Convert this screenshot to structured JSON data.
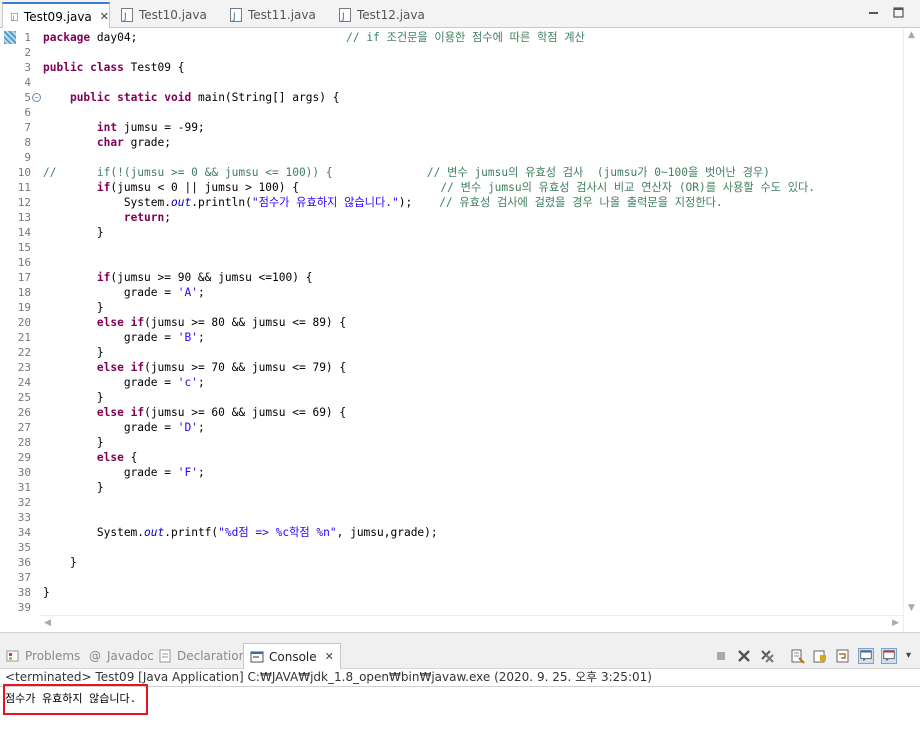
{
  "editor_tabs": [
    {
      "label": "Test09.java",
      "active": true
    },
    {
      "label": "Test10.java",
      "active": false
    },
    {
      "label": "Test11.java",
      "active": false
    },
    {
      "label": "Test12.java",
      "active": false
    }
  ],
  "code_lines": [
    {
      "n": "1",
      "html": "<span class=\"kw\">package</span> day04;                               <span class=\"cm\">// if 조건문을 이용한 점수에 따른 학점 계산</span>"
    },
    {
      "n": "2",
      "html": ""
    },
    {
      "n": "3",
      "html": "<span class=\"kw\">public</span> <span class=\"kw\">class</span> Test09 {"
    },
    {
      "n": "4",
      "html": ""
    },
    {
      "n": "5",
      "html": "    <span class=\"kw\">public</span> <span class=\"kw\">static</span> <span class=\"kw\">void</span> main(String[] args) {"
    },
    {
      "n": "6",
      "html": ""
    },
    {
      "n": "7",
      "html": "        <span class=\"kw\">int</span> jumsu = -99;"
    },
    {
      "n": "8",
      "html": "        <span class=\"kw\">char</span> grade;"
    },
    {
      "n": "9",
      "html": ""
    },
    {
      "n": "10",
      "html": "<span class=\"cm\">//      if(!(jumsu >= 0 &amp;&amp; jumsu <= 100)) {              // 변수 jumsu의 유효성 검사  (jumsu가 0~100을 벗어난 경우)</span>"
    },
    {
      "n": "11",
      "html": "        <span class=\"kw\">if</span>(jumsu < 0 || jumsu > 100) {                     <span class=\"cm\">// 변수 jumsu의 유효성 검사시 비교 연산자 (OR)를 사용할 수도 있다.</span>"
    },
    {
      "n": "12",
      "html": "            System.<span class=\"fl\">out</span>.println(<span class=\"st\">\"점수가 유효하지 않습니다.\"</span>);    <span class=\"cm\">// 유효성 검사에 걸렸을 경우 나올 출력문을 지정한다.</span>"
    },
    {
      "n": "13",
      "html": "            <span class=\"kw\">return</span>;"
    },
    {
      "n": "14",
      "html": "        }"
    },
    {
      "n": "15",
      "html": ""
    },
    {
      "n": "16",
      "html": ""
    },
    {
      "n": "17",
      "html": "        <span class=\"kw\">if</span>(jumsu >= 90 &amp;&amp; jumsu <=100) {"
    },
    {
      "n": "18",
      "html": "            grade = <span class=\"st\">'A'</span>;"
    },
    {
      "n": "19",
      "html": "        }"
    },
    {
      "n": "20",
      "html": "        <span class=\"kw\">else</span> <span class=\"kw\">if</span>(jumsu >= 80 &amp;&amp; jumsu <= 89) {"
    },
    {
      "n": "21",
      "html": "            grade = <span class=\"st\">'B'</span>;"
    },
    {
      "n": "22",
      "html": "        }"
    },
    {
      "n": "23",
      "html": "        <span class=\"kw\">else</span> <span class=\"kw\">if</span>(jumsu >= 70 &amp;&amp; jumsu <= 79) {"
    },
    {
      "n": "24",
      "html": "            grade = <span class=\"st\">'c'</span>;"
    },
    {
      "n": "25",
      "html": "        }"
    },
    {
      "n": "26",
      "html": "        <span class=\"kw\">else</span> <span class=\"kw\">if</span>(jumsu >= 60 &amp;&amp; jumsu <= 69) {"
    },
    {
      "n": "27",
      "html": "            grade = <span class=\"st\">'D'</span>;"
    },
    {
      "n": "28",
      "html": "        }"
    },
    {
      "n": "29",
      "html": "        <span class=\"kw\">else</span> {"
    },
    {
      "n": "30",
      "html": "            grade = <span class=\"st\">'F'</span>;"
    },
    {
      "n": "31",
      "html": "        }"
    },
    {
      "n": "32",
      "html": ""
    },
    {
      "n": "33",
      "html": ""
    },
    {
      "n": "34",
      "html": "        System.<span class=\"fl\">out</span>.printf(<span class=\"st\">\"%d점 => %c학점 %n\"</span>, jumsu,grade);"
    },
    {
      "n": "35",
      "html": ""
    },
    {
      "n": "36",
      "html": "    }"
    },
    {
      "n": "37",
      "html": ""
    },
    {
      "n": "38",
      "html": "}"
    },
    {
      "n": "39",
      "html": ""
    }
  ],
  "bottom_tabs": {
    "problems": "Problems",
    "javadoc": "Javadoc",
    "declaration": "Declaration",
    "console": "Console"
  },
  "console": {
    "status": "<terminated> Test09 [Java Application] C:₩JAVA₩jdk_1.8_open₩bin₩javaw.exe (2020. 9. 25. 오후 3:25:01)",
    "output": "점수가 유효하지 않습니다."
  },
  "colors": {
    "keyword": "#7f0055",
    "comment": "#3f7f5f",
    "string": "#2a00ff",
    "field": "#0000c0",
    "highlight_box": "#e6141e",
    "active_tab_accent": "#3a7ed1"
  }
}
